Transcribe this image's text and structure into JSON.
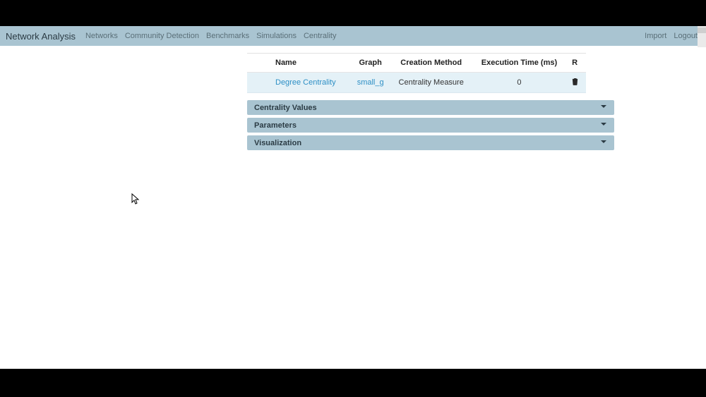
{
  "nav": {
    "brand": "Network Analysis",
    "left": [
      "Networks",
      "Community Detection",
      "Benchmarks",
      "Simulations",
      "Centrality"
    ],
    "right": [
      "Import",
      "Logout"
    ]
  },
  "table": {
    "headers": {
      "name": "Name",
      "graph": "Graph",
      "creation": "Creation Method",
      "exec": "Execution Time (ms)",
      "r": "R"
    },
    "rows": [
      {
        "name": "Degree Centrality",
        "graph": "small_g",
        "creation": "Centrality Measure",
        "exec": "0"
      }
    ]
  },
  "accordions": [
    "Centrality Values",
    "Parameters",
    "Visualization"
  ]
}
